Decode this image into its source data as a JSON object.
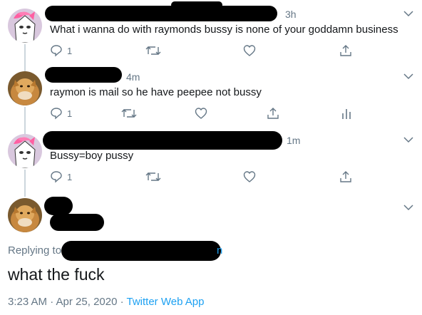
{
  "tweets": [
    {
      "time": "3h",
      "text": "What i wanna do with raymonds bussy is none of your goddamn business",
      "reply_count": "1",
      "avatar": "pink-haired-cartoon-avatar"
    },
    {
      "time": "4m",
      "text": "raymon is mail so he have peepee not bussy",
      "reply_count": "1",
      "avatar": "blurry-cat-photo-avatar"
    },
    {
      "time": "1m",
      "text": "Bussy=boy pussy",
      "reply_count": "1",
      "avatar": "pink-haired-cartoon-avatar"
    }
  ],
  "main_tweet": {
    "replying_label": "Replying to",
    "reply_handle_tail": "n",
    "text": "what the fuck",
    "timestamp": "3:23 AM · Apr 25, 2020",
    "separator": " · ",
    "source": "Twitter Web App",
    "avatar": "blurry-cat-photo-avatar"
  },
  "colors": {
    "text": "#14171a",
    "muted": "#657786",
    "link": "#1da1f2",
    "icon": "#657786",
    "thread_line": "#ccd6dd"
  },
  "icons": [
    "reply-icon",
    "retweet-icon",
    "like-icon",
    "share-icon",
    "analytics-icon",
    "chevron-down-icon"
  ]
}
